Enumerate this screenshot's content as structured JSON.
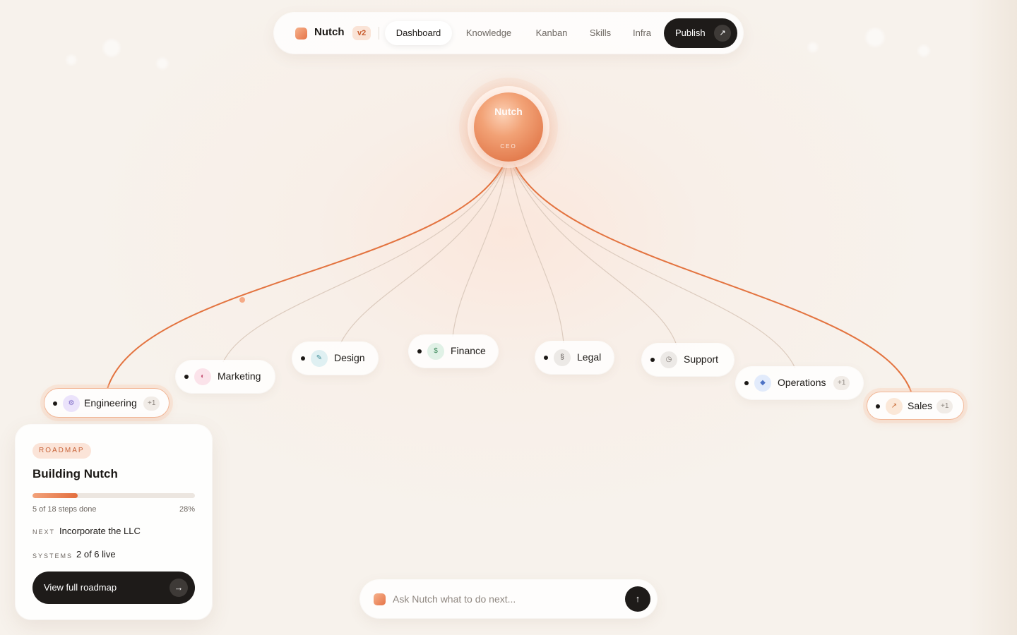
{
  "nav": {
    "brand": "Nutch",
    "version": "v2",
    "tabs": [
      {
        "label": "Dashboard",
        "active": true
      },
      {
        "label": "Knowledge",
        "active": false
      },
      {
        "label": "Kanban",
        "active": false
      },
      {
        "label": "Skills",
        "active": false
      },
      {
        "label": "Infra",
        "active": false
      }
    ],
    "publish_label": "Publish",
    "publish_icon": "arrow-up-right-icon"
  },
  "ceo": {
    "name": "Nutch",
    "role": "CEO"
  },
  "departments": [
    {
      "label": "Engineering",
      "icon": "gear-icon",
      "badge": "+1",
      "highlighted": true,
      "icon_color": "#ebe3fb"
    },
    {
      "label": "Marketing",
      "icon": "contrast-icon",
      "badge": "",
      "highlighted": false,
      "icon_color": "#fbe3ea"
    },
    {
      "label": "Design",
      "icon": "pencil-icon",
      "badge": "",
      "highlighted": false,
      "icon_color": "#dff0f2"
    },
    {
      "label": "Finance",
      "icon": "dollar-icon",
      "badge": "",
      "highlighted": false,
      "icon_color": "#e0f1e6"
    },
    {
      "label": "Legal",
      "icon": "section-icon",
      "badge": "",
      "highlighted": false,
      "icon_color": "#ece9e6"
    },
    {
      "label": "Support",
      "icon": "clock-icon",
      "badge": "",
      "highlighted": false,
      "icon_color": "#ece9e6"
    },
    {
      "label": "Operations",
      "icon": "diamond-icon",
      "badge": "+1",
      "highlighted": false,
      "icon_color": "#e2ebfb"
    },
    {
      "label": "Sales",
      "icon": "arrow-up-right-icon",
      "badge": "+1",
      "highlighted": true,
      "icon_color": "#fbe8d8"
    }
  ],
  "roadmap": {
    "badge": "ROADMAP",
    "title": "Building Nutch",
    "progress": 0.28,
    "steps_text": "5 of 18 steps done",
    "percent_text": "28%",
    "next_key": "NEXT",
    "next_value": "Incorporate the LLC",
    "systems_key": "SYSTEMS",
    "systems_value": "2 of 6 live",
    "button_label": "View full roadmap",
    "button_icon": "arrow-right-icon"
  },
  "ask": {
    "placeholder": "Ask Nutch what to do next...",
    "send_icon": "arrow-up-icon"
  },
  "colors": {
    "accent": "#e3733f",
    "dark": "#1e1b19"
  }
}
